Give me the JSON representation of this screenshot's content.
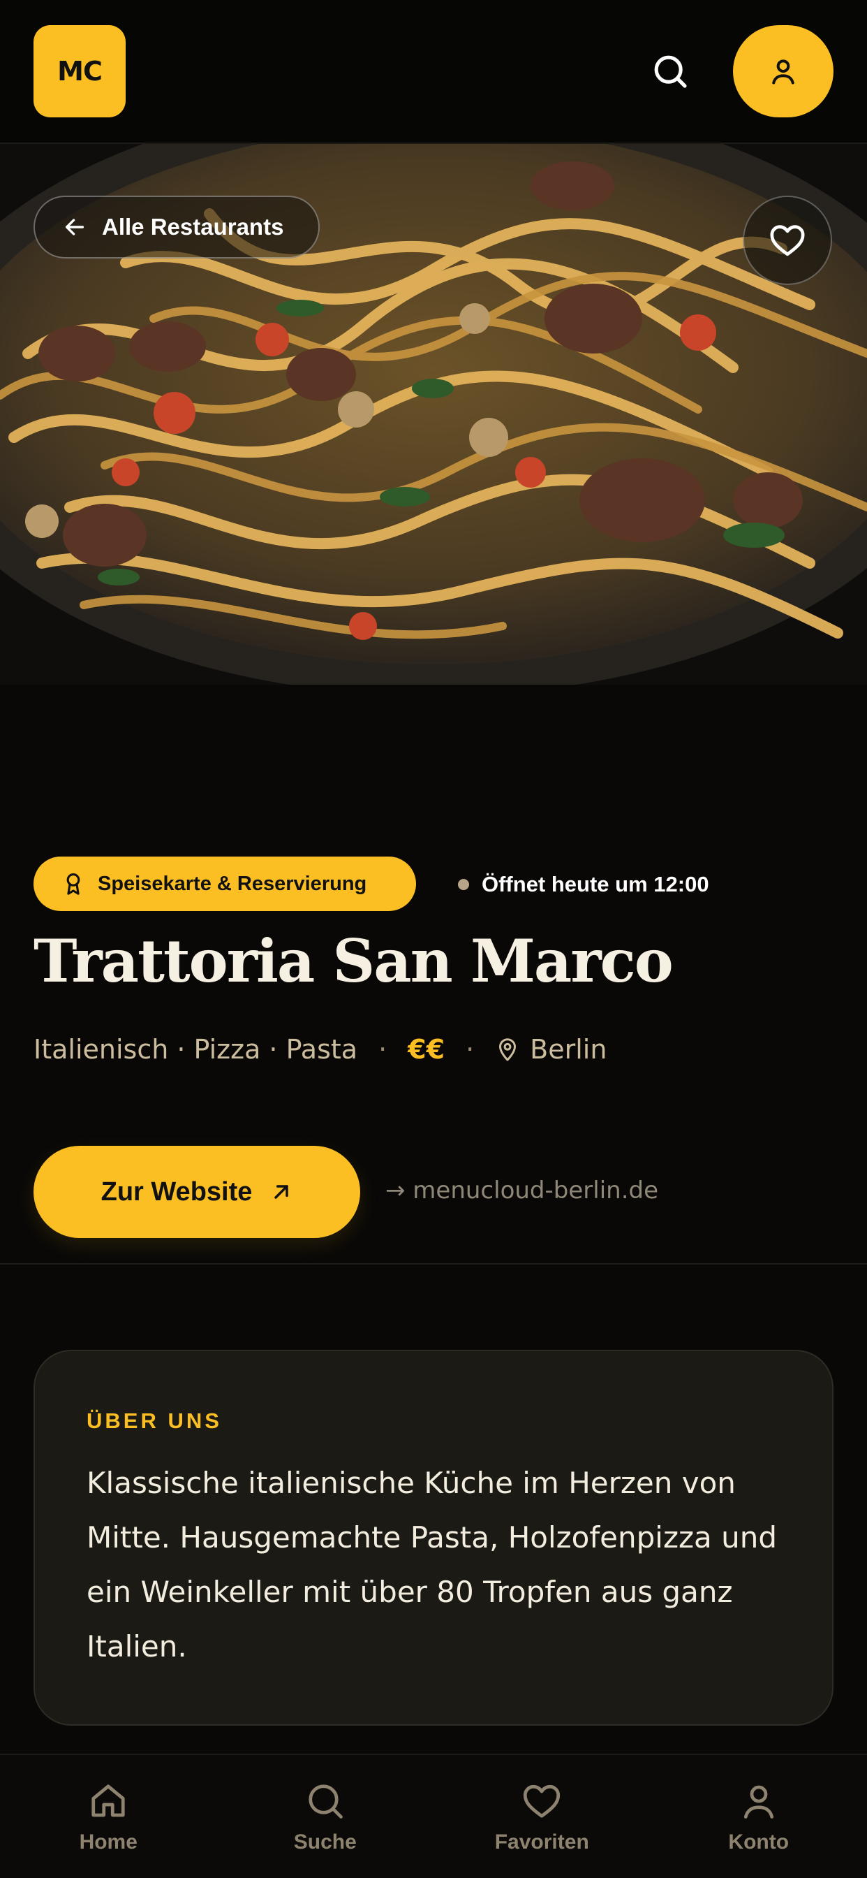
{
  "header": {
    "logo_text": "MC",
    "search_icon": "search-icon",
    "account_icon": "user-icon"
  },
  "hero": {
    "image_description_icon": "food-photo",
    "back_label": "Alle Restaurants",
    "favorite_icon": "heart-icon"
  },
  "restaurant": {
    "badge_label": "Speisekarte & Reservierung",
    "badge_icon": "award-icon",
    "open_status": "Öffnet heute um 12:00",
    "name": "Trattoria San Marco",
    "cuisines": "Italienisch · Pizza · Pasta",
    "separator": "·",
    "price": "€€",
    "city": "Berlin",
    "website_button": "Zur Website",
    "website_link": "→ menucloud-berlin.de"
  },
  "about": {
    "heading": "ÜBER UNS",
    "text": "Klassische italienische Küche im Herzen von Mitte. Hausgemachte Pasta, Holzofenpizza und ein Weinkeller mit über 80 Tropfen aus ganz Italien."
  },
  "nav": {
    "items": [
      {
        "label": "Home",
        "icon": "home-icon"
      },
      {
        "label": "Suche",
        "icon": "search-icon"
      },
      {
        "label": "Favoriten",
        "icon": "heart-icon"
      },
      {
        "label": "Konto",
        "icon": "user-icon"
      }
    ]
  },
  "colors": {
    "accent": "#fbbf24",
    "background": "#090807",
    "card": "#1b1a14"
  }
}
